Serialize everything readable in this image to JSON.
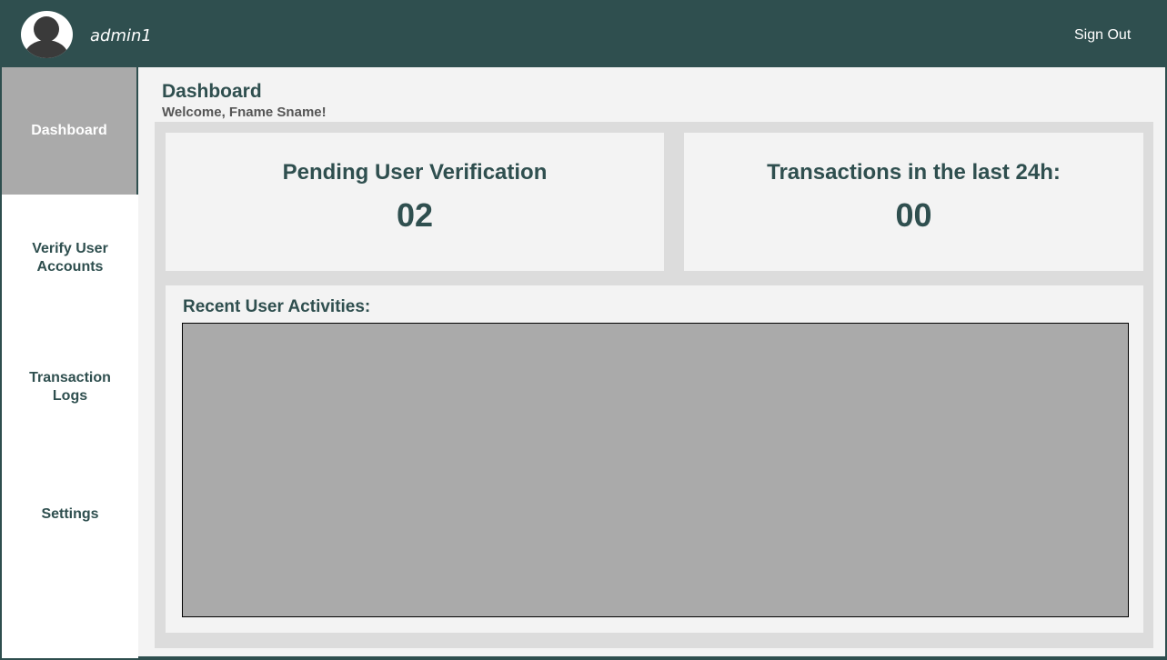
{
  "header": {
    "username": "admin1",
    "signout_label": "Sign Out"
  },
  "sidebar": {
    "items": [
      {
        "label": "Dashboard",
        "active": true
      },
      {
        "label": "Verify User Accounts",
        "active": false
      },
      {
        "label": "Transaction Logs",
        "active": false
      },
      {
        "label": "Settings",
        "active": false
      }
    ]
  },
  "main": {
    "title": "Dashboard",
    "subtitle": "Welcome, Fname Sname!",
    "cards": [
      {
        "label": "Pending User Verification",
        "value": "02"
      },
      {
        "label": "Transactions in the last 24h:",
        "value": "00"
      }
    ],
    "activities_title": "Recent User Activities:"
  },
  "colors": {
    "primary": "#2f4f4f",
    "active_nav": "#aaaaaa",
    "panel": "#f3f3f3",
    "content_bg": "#dcdcdc"
  }
}
